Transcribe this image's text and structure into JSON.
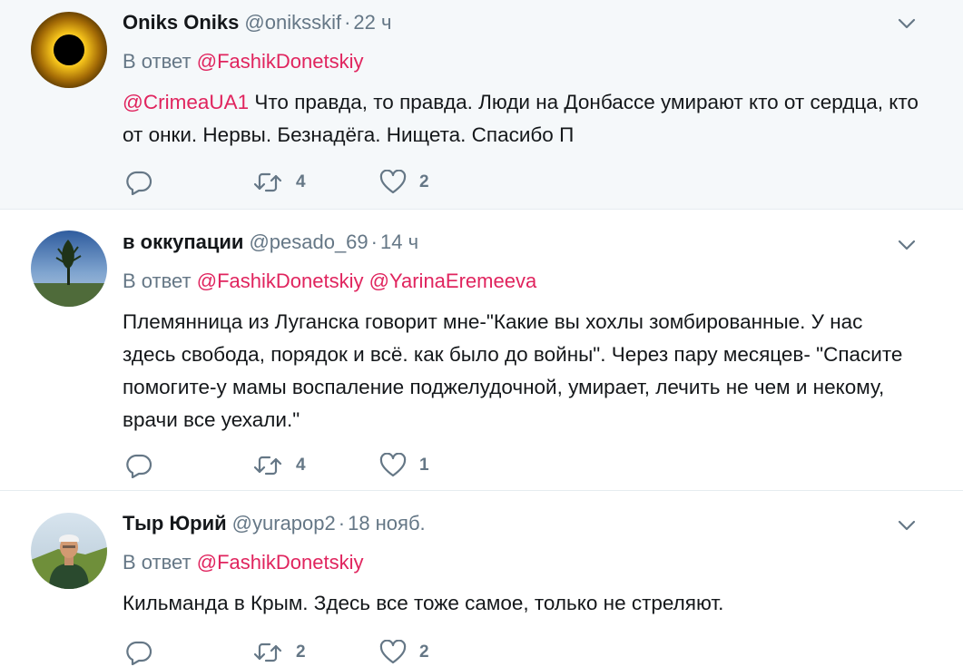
{
  "tweets": [
    {
      "name": "Oniks Oniks",
      "handle": "@oniksskif",
      "separator": "·",
      "time": "22 ч",
      "reply_prefix": "В ответ",
      "reply_to": [
        "@FashikDonetskiy"
      ],
      "mention": "@CrimeaUA1",
      "text": " Что правда, то правда. Люди на Донбассе умирают кто от сердца, кто от онки. Нервы. Безнадёга. Нищета.  Спасибо П",
      "retweets": "4",
      "likes": "2",
      "avatar_icon": "eclipse-sun-avatar"
    },
    {
      "name": "в оккупации",
      "handle": "@pesado_69",
      "separator": "·",
      "time": "14 ч",
      "reply_prefix": "В ответ",
      "reply_to": [
        "@FashikDonetskiy",
        "@YarinaEremeeva"
      ],
      "text": "Племянница из Луганска говорит мне-\"Какие вы хохлы зомбированные. У нас здесь свобода, порядок и всё. как было до войны\". Через пару месяцев- \"Спасите помогите-у мамы воспаление поджелудочной, умирает, лечить не чем и некому, врачи все уехали.\"",
      "retweets": "4",
      "likes": "1",
      "avatar_icon": "lone-tree-avatar"
    },
    {
      "name": "Тыр Юрий",
      "handle": "@yurapop2",
      "separator": "·",
      "time": "18 нояб.",
      "reply_prefix": "В ответ",
      "reply_to": [
        "@FashikDonetskiy"
      ],
      "text": "Кильманда в Крым. Здесь все тоже самое, только не стреляют.",
      "retweets": "2",
      "likes": "2",
      "avatar_icon": "person-photo-avatar"
    }
  ],
  "icons": {
    "reply": "reply-icon",
    "retweet": "retweet-icon",
    "like": "heart-icon",
    "menu": "chevron-down-icon"
  },
  "colors": {
    "link": "#e0245e",
    "secondary_text": "#657786",
    "primary_text": "#14171a",
    "highlight_bg": "#f5f8fa",
    "divider": "#e6ecf0"
  }
}
